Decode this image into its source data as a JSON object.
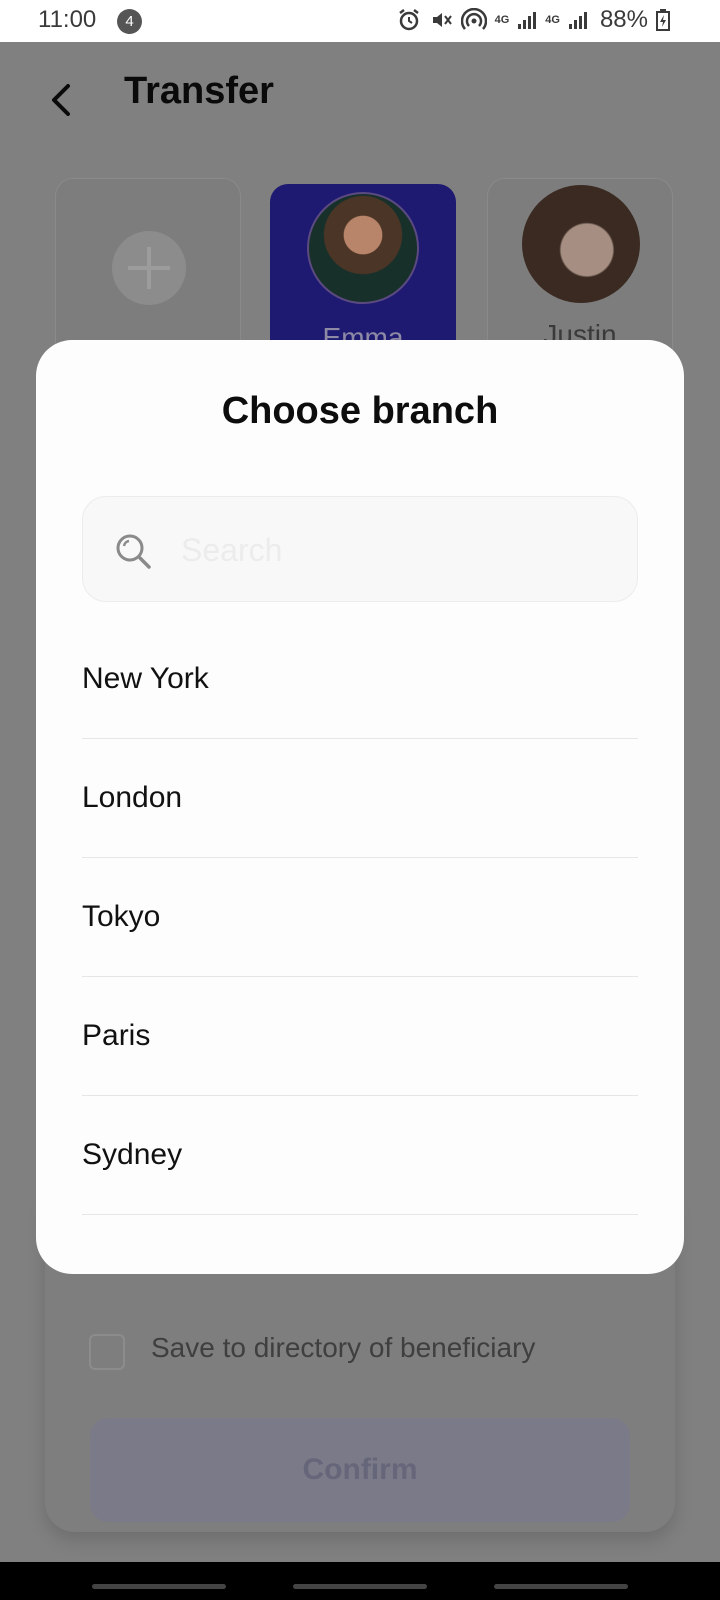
{
  "status_bar": {
    "time": "11:00",
    "notification_count": "4",
    "network_1": "4G",
    "network_2": "4G",
    "battery": "88%"
  },
  "header": {
    "title": "Transfer"
  },
  "contacts": [
    {
      "name": ""
    },
    {
      "name": "Emma",
      "selected": true
    },
    {
      "name": "Justin"
    }
  ],
  "form": {
    "save_label": "Save to directory of beneficiary",
    "confirm_label": "Confirm"
  },
  "dialog": {
    "title": "Choose branch",
    "search_placeholder": "Search",
    "branches": [
      {
        "label": "New York"
      },
      {
        "label": "London"
      },
      {
        "label": "Tokyo"
      },
      {
        "label": "Paris"
      },
      {
        "label": "Sydney"
      }
    ]
  },
  "colors": {
    "accent": "#1e1a72",
    "overlay": "#808080"
  }
}
